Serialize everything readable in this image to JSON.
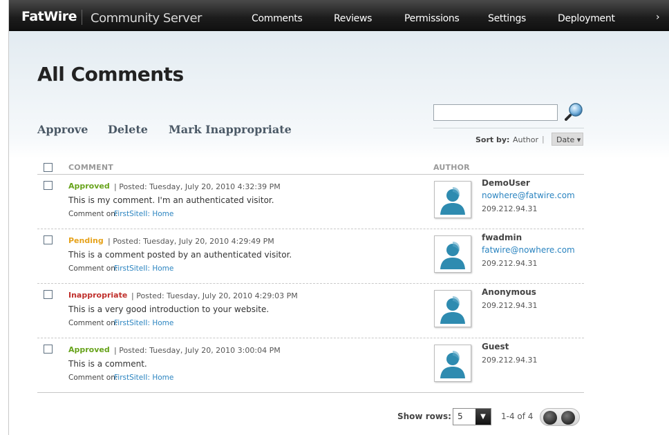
{
  "header": {
    "brand": "FatWire",
    "product": "Community Server",
    "nav": [
      "Comments",
      "Reviews",
      "Permissions",
      "Settings",
      "Deployment"
    ]
  },
  "page": {
    "title": "All Comments"
  },
  "actions": {
    "approve": "Approve",
    "delete": "Delete",
    "mark_inappropriate": "Mark Inappropriate"
  },
  "search": {
    "value": "",
    "placeholder": ""
  },
  "sort": {
    "label": "Sort by:",
    "author": "Author",
    "separator": "|",
    "date": "Date ▾"
  },
  "table": {
    "col_comment": "COMMENT",
    "col_author": "AUTHOR"
  },
  "comments": [
    {
      "status": "Approved",
      "status_color": "#67a31b",
      "posted": "| Posted: Tuesday, July 20, 2010 4:32:39 PM",
      "text": "This is my comment. I'm an authenticated visitor.",
      "comment_on_label": "Comment on:",
      "comment_on_link": "FirstSiteII: Home",
      "author": "DemoUser",
      "email": "nowhere@fatwire.com",
      "ip": "209.212.94.31"
    },
    {
      "status": "Pending",
      "status_color": "#e6a21a",
      "posted": "| Posted: Tuesday, July 20, 2010 4:29:49 PM",
      "text": "This is a comment posted by an authenticated visitor.",
      "comment_on_label": "Comment on:",
      "comment_on_link": "FirstSiteII: Home",
      "author": "fwadmin",
      "email": "fatwire@nowhere.com",
      "ip": "209.212.94.31"
    },
    {
      "status": "Inappropriate",
      "status_color": "#c0302c",
      "posted": "| Posted: Tuesday, July 20, 2010 4:29:03 PM",
      "text": "This is a very good introduction to your website.",
      "comment_on_label": "Comment on:",
      "comment_on_link": "FirstSiteII: Home",
      "author": "Anonymous",
      "email": "",
      "ip": "209.212.94.31"
    },
    {
      "status": "Approved",
      "status_color": "#67a31b",
      "posted": "| Posted: Tuesday, July 20, 2010 3:00:04 PM",
      "text": "This is a comment.",
      "comment_on_label": "Comment on:",
      "comment_on_link": "FirstSiteII: Home",
      "author": "Guest",
      "email": "",
      "ip": "209.212.94.31"
    }
  ],
  "pager": {
    "rows_label": "Show rows:",
    "rows_value": "5",
    "count": "1-4 of 4"
  },
  "icons": {
    "search": "magnifier-icon",
    "avatar": "user-silhouette-icon",
    "prev": "prev-page-icon",
    "next": "next-page-icon",
    "dropdown": "chevron-down-icon"
  },
  "colors": {
    "link": "#2b84c0",
    "topbar": "#1c1c1c",
    "avatar": "#2e8bb0"
  }
}
